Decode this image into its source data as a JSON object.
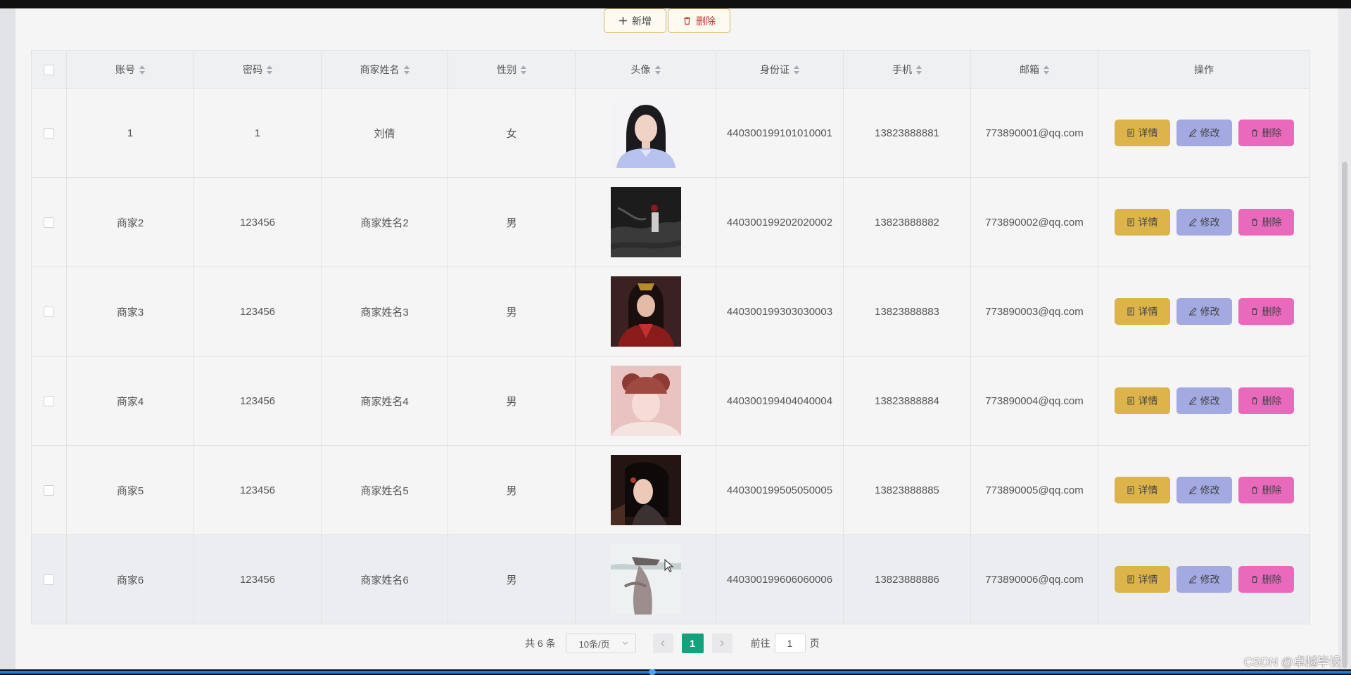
{
  "toolbar": {
    "add_label": "新增",
    "delete_label": "删除"
  },
  "table": {
    "headers": [
      "账号",
      "密码",
      "商家姓名",
      "性别",
      "头像",
      "身份证",
      "手机",
      "邮箱",
      "操作"
    ],
    "rows": [
      {
        "account": "1",
        "password": "1",
        "name": "刘倩",
        "gender": "女",
        "id_card": "440300199101010001",
        "phone": "13823888881",
        "email": "773890001@qq.com"
      },
      {
        "account": "商家2",
        "password": "123456",
        "name": "商家姓名2",
        "gender": "男",
        "id_card": "440300199202020002",
        "phone": "13823888882",
        "email": "773890002@qq.com"
      },
      {
        "account": "商家3",
        "password": "123456",
        "name": "商家姓名3",
        "gender": "男",
        "id_card": "440300199303030003",
        "phone": "13823888883",
        "email": "773890003@qq.com"
      },
      {
        "account": "商家4",
        "password": "123456",
        "name": "商家姓名4",
        "gender": "男",
        "id_card": "440300199404040004",
        "phone": "13823888884",
        "email": "773890004@qq.com"
      },
      {
        "account": "商家5",
        "password": "123456",
        "name": "商家姓名5",
        "gender": "男",
        "id_card": "440300199505050005",
        "phone": "13823888885",
        "email": "773890005@qq.com"
      },
      {
        "account": "商家6",
        "password": "123456",
        "name": "商家姓名6",
        "gender": "男",
        "id_card": "440300199606060006",
        "phone": "13823888886",
        "email": "773890006@qq.com"
      }
    ],
    "actions": {
      "detail": "详情",
      "edit": "修改",
      "delete": "删除"
    }
  },
  "pagination": {
    "total": "共 6 条",
    "page_size": "10条/页",
    "current_page": "1",
    "goto_prefix": "前往",
    "goto_value": "1",
    "goto_suffix": "页"
  },
  "watermark": "CSDN @卓越毕设",
  "colors": {
    "detail": "#dcb44a",
    "edit": "#a3a9e1",
    "delete": "#e969bd",
    "active_page": "#12a27c"
  }
}
